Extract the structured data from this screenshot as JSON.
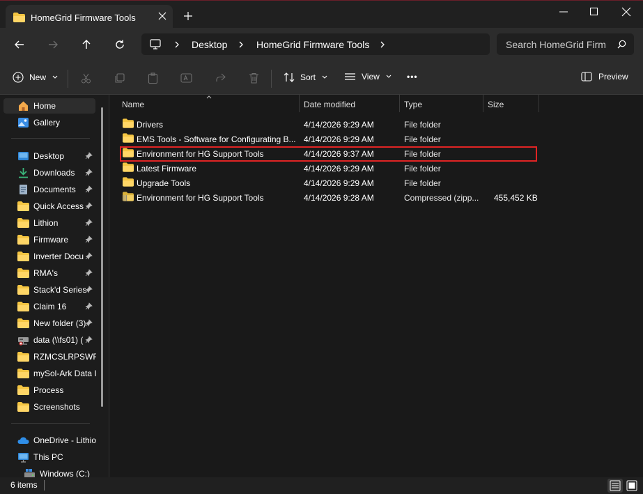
{
  "window": {
    "tab_title": "HomeGrid Firmware Tools",
    "controls": [
      "minimize-icon",
      "maximize-icon",
      "close-icon"
    ]
  },
  "address": {
    "crumbs": [
      "Desktop",
      "HomeGrid Firmware Tools"
    ],
    "search_placeholder": "Search HomeGrid Firm"
  },
  "toolbar": {
    "new_label": "New",
    "sort_label": "Sort",
    "view_label": "View",
    "more_label": "•••",
    "preview_label": "Preview"
  },
  "sidebar": {
    "top": [
      "Home",
      "Gallery"
    ],
    "pinned": [
      "Desktop",
      "Downloads",
      "Documents",
      "Quick Access",
      "Lithion",
      "Firmware",
      "Inverter Docu",
      "RMA's",
      "Stack'd Series",
      "Claim 16",
      "New folder (3)",
      "data (\\\\fs01) (",
      "RZMCSLRPSWRN",
      "mySol-Ark Data I",
      "Process",
      "Screenshots"
    ],
    "bottom": [
      "OneDrive - Lithio",
      "This PC",
      "Windows (C:)"
    ]
  },
  "columns": [
    "Name",
    "Date modified",
    "Type",
    "Size"
  ],
  "files": [
    {
      "name": "Drivers",
      "date": "4/14/2026 9:29 AM",
      "type": "File folder",
      "size": "",
      "icon": "folder-icon"
    },
    {
      "name": "EMS Tools - Software for Configurating B...",
      "date": "4/14/2026 9:29 AM",
      "type": "File folder",
      "size": "",
      "icon": "folder-icon"
    },
    {
      "name": "Environment for HG Support Tools",
      "date": "4/14/2026 9:37 AM",
      "type": "File folder",
      "size": "",
      "icon": "folder-icon"
    },
    {
      "name": "Latest Firmware",
      "date": "4/14/2026 9:29 AM",
      "type": "File folder",
      "size": "",
      "icon": "folder-icon"
    },
    {
      "name": "Upgrade Tools",
      "date": "4/14/2026 9:29 AM",
      "type": "File folder",
      "size": "",
      "icon": "folder-icon"
    },
    {
      "name": "Environment for HG Support Tools",
      "date": "4/14/2026 9:28 AM",
      "type": "Compressed (zipp...",
      "size": "455,452 KB",
      "icon": "zip-folder-icon"
    }
  ],
  "status": {
    "items_text": "6 items"
  },
  "colors": {
    "accent": "#0067c0",
    "folder": "#f4c542",
    "highlight": "#e02424"
  }
}
